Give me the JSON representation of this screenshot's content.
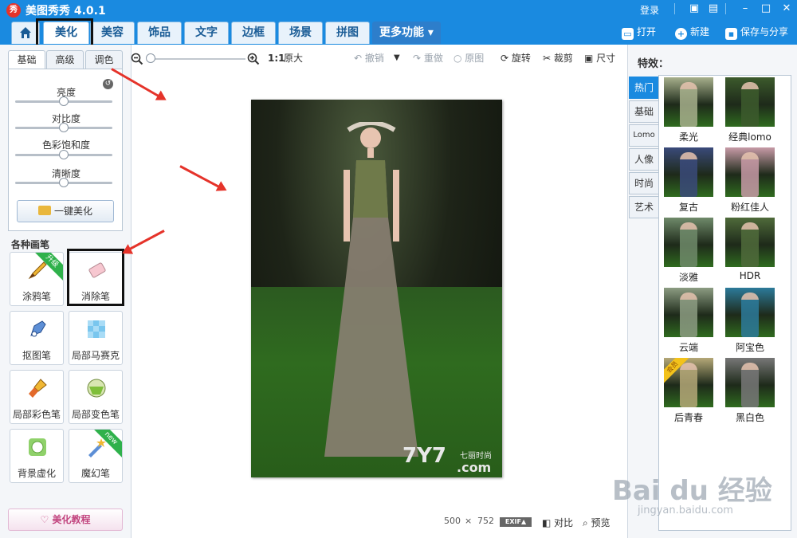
{
  "app": {
    "logo": "秀",
    "title": "美图秀秀 4.0.1",
    "login": "登录"
  },
  "window_icons": {
    "message": "message-icon",
    "feedback": "feedback-icon",
    "minimize": "–",
    "maximize": "□",
    "close": "✕"
  },
  "main_tabs": [
    {
      "label": ""
    },
    {
      "label": "美化"
    },
    {
      "label": "美容"
    },
    {
      "label": "饰品"
    },
    {
      "label": "文字"
    },
    {
      "label": "边框"
    },
    {
      "label": "场景"
    },
    {
      "label": "拼图"
    },
    {
      "label": "更多功能"
    }
  ],
  "top_right": {
    "open": "打开",
    "new": "新建",
    "save_share": "保存与分享"
  },
  "left_tabs": [
    "基础",
    "高级",
    "调色"
  ],
  "adjust": {
    "brightness": "亮度",
    "contrast": "对比度",
    "saturation": "色彩饱和度",
    "sharpness": "清晰度",
    "one_click": "一键美化"
  },
  "brush_section": "各种画笔",
  "brushes": [
    {
      "label": "涂鸦笔",
      "badge": "升级"
    },
    {
      "label": "消除笔",
      "badge": ""
    },
    {
      "label": "抠图笔",
      "badge": ""
    },
    {
      "label": "局部马赛克",
      "badge": ""
    },
    {
      "label": "局部彩色笔",
      "badge": ""
    },
    {
      "label": "局部变色笔",
      "badge": ""
    },
    {
      "label": "背景虚化",
      "badge": ""
    },
    {
      "label": "魔幻笔",
      "badge": "new"
    }
  ],
  "tutorial": "美化教程",
  "toolbar": {
    "ratio": "1:1",
    "original_size": "原大",
    "undo": "撤销",
    "redo": "重做",
    "original": "原图",
    "rotate": "旋转",
    "crop": "裁剪",
    "size": "尺寸"
  },
  "photo": {
    "watermark": "7Y7",
    "watermark_cn": "七丽时尚",
    "watermark_com": ".com"
  },
  "status": {
    "width": "500",
    "x": "×",
    "height": "752",
    "exif": "EXIF▲",
    "compare": "对比",
    "preview": "预览"
  },
  "effects": {
    "title": "特效：",
    "tabs": [
      "热门",
      "基础",
      "Lomo",
      "人像",
      "时尚",
      "艺术"
    ],
    "items": [
      {
        "label": "柔光",
        "color": "#a7b08c"
      },
      {
        "label": "经典lomo",
        "color": "#3c5a2c"
      },
      {
        "label": "复古",
        "color": "#3a4a7a"
      },
      {
        "label": "粉红佳人",
        "color": "#c79aa6"
      },
      {
        "label": "淡雅",
        "color": "#6f8a6a"
      },
      {
        "label": "HDR",
        "color": "#4f6a3a"
      },
      {
        "label": "云端",
        "color": "#8c9c82"
      },
      {
        "label": "阿宝色",
        "color": "#2c7a9a"
      },
      {
        "label": "后青春",
        "color": "#b5a878",
        "badge": "会员"
      },
      {
        "label": "黑白色",
        "color": "#777777"
      }
    ]
  },
  "baidu": {
    "brand": "Bai du 经验",
    "url": "jingyan.baidu.com"
  }
}
